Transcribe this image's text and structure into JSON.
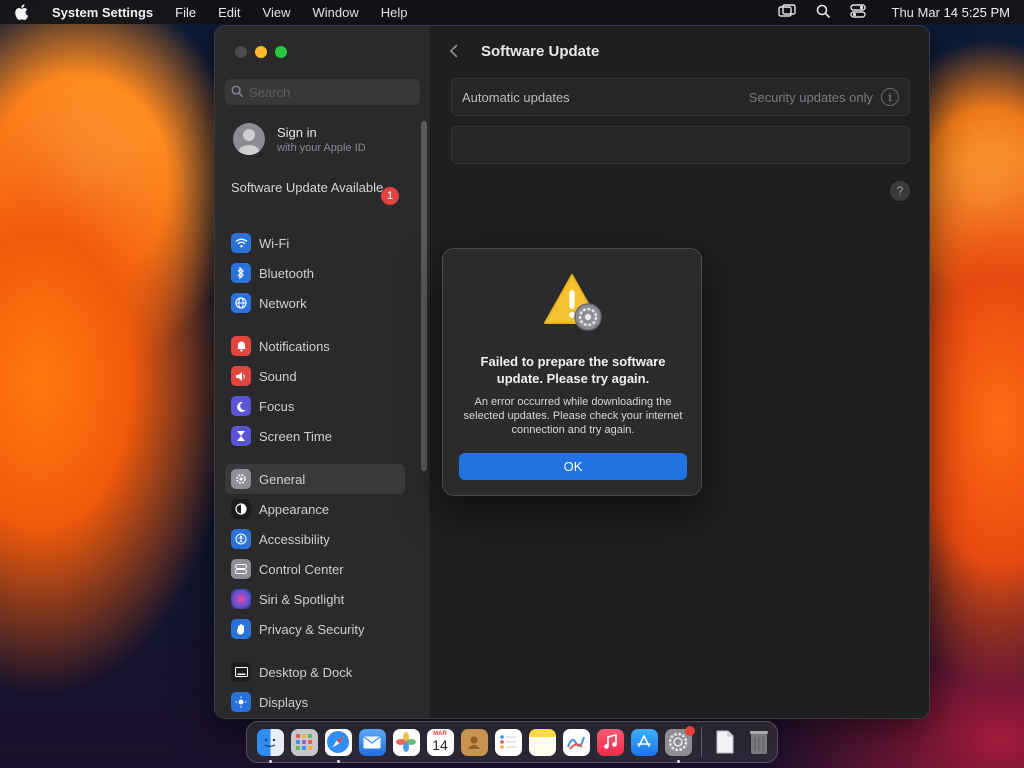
{
  "menubar": {
    "app_name": "System Settings",
    "menus": [
      "File",
      "Edit",
      "View",
      "Window",
      "Help"
    ],
    "clock": "Thu Mar 14  5:25 PM"
  },
  "sidebar": {
    "search_placeholder": "Search",
    "signin_title": "Sign in",
    "signin_subtitle": "with your Apple ID",
    "update_label": "Software Update Available",
    "update_badge": "1",
    "groups": [
      [
        {
          "label": "Wi-Fi",
          "icon": "wifi-icon",
          "color": "#2a72d8"
        },
        {
          "label": "Bluetooth",
          "icon": "bluetooth-icon",
          "color": "#2a72d8"
        },
        {
          "label": "Network",
          "icon": "network-icon",
          "color": "#2a72d8"
        }
      ],
      [
        {
          "label": "Notifications",
          "icon": "notifications-icon",
          "color": "#e1463f"
        },
        {
          "label": "Sound",
          "icon": "sound-icon",
          "color": "#e1463f"
        },
        {
          "label": "Focus",
          "icon": "focus-icon",
          "color": "#5a53d6"
        },
        {
          "label": "Screen Time",
          "icon": "screen-time-icon",
          "color": "#5a53d6"
        }
      ],
      [
        {
          "label": "General",
          "icon": "general-icon",
          "color": "#8e8e93",
          "selected": true
        },
        {
          "label": "Appearance",
          "icon": "appearance-icon",
          "color": "#1c1c1e"
        },
        {
          "label": "Accessibility",
          "icon": "accessibility-icon",
          "color": "#2a72d8"
        },
        {
          "label": "Control Center",
          "icon": "control-center-icon",
          "color": "#8e8e93"
        },
        {
          "label": "Siri & Spotlight",
          "icon": "siri-icon",
          "color": "#b04bd9"
        },
        {
          "label": "Privacy & Security",
          "icon": "privacy-icon",
          "color": "#2a72d8"
        }
      ],
      [
        {
          "label": "Desktop & Dock",
          "icon": "desktop-dock-icon",
          "color": "#1c1c1e"
        },
        {
          "label": "Displays",
          "icon": "displays-icon",
          "color": "#2a72d8"
        }
      ]
    ]
  },
  "main": {
    "title": "Software Update",
    "automatic_label": "Automatic updates",
    "automatic_value": "Security updates only",
    "help": "?"
  },
  "dialog": {
    "title": "Failed to prepare the software update. Please try again.",
    "message": "An error occurred while downloading the selected updates. Please check your internet connection and try again.",
    "ok_label": "OK"
  },
  "dock": {
    "calendar_month": "MAR",
    "calendar_day": "14",
    "apps": [
      {
        "name": "finder-icon",
        "color": "#3a8ef0"
      },
      {
        "name": "launchpad-icon",
        "color": "#c7c7cc"
      },
      {
        "name": "safari-icon",
        "color": "#2f8ef5"
      },
      {
        "name": "mail-icon",
        "color": "#3b8ff0"
      },
      {
        "name": "photos-icon",
        "color": "#f5f5f5"
      },
      {
        "name": "calendar-icon",
        "color": "#ffffff"
      },
      {
        "name": "contacts-icon",
        "color": "#c7934f"
      },
      {
        "name": "reminders-icon",
        "color": "#ffffff"
      },
      {
        "name": "notes-icon",
        "color": "#ffd84a"
      },
      {
        "name": "freeform-icon",
        "color": "#ffffff"
      },
      {
        "name": "music-icon",
        "color": "#f5415a"
      },
      {
        "name": "app-store-icon",
        "color": "#1d8ff5"
      },
      {
        "name": "system-settings-icon",
        "color": "#8e8e93"
      }
    ]
  }
}
